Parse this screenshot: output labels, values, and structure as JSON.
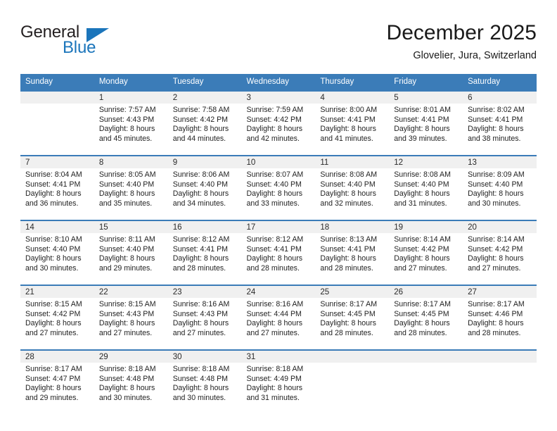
{
  "brand": {
    "line1": "General",
    "line2": "Blue",
    "triangle_icon": "triangle-icon",
    "color_dark": "#231f20",
    "color_blue": "#1b75bb"
  },
  "header": {
    "month_title": "December 2025",
    "location": "Glovelier, Jura, Switzerland"
  },
  "theme": {
    "header_blue": "#3b7cb8",
    "daynum_band": "#f0f0f0",
    "text": "#1a1a1a"
  },
  "calendar": {
    "weekdays": [
      "Sunday",
      "Monday",
      "Tuesday",
      "Wednesday",
      "Thursday",
      "Friday",
      "Saturday"
    ],
    "weeks": [
      [
        {
          "day": "",
          "empty": true,
          "sunrise": "",
          "sunset": "",
          "daylight1": "",
          "daylight2": ""
        },
        {
          "day": "1",
          "sunrise": "Sunrise: 7:57 AM",
          "sunset": "Sunset: 4:43 PM",
          "daylight1": "Daylight: 8 hours",
          "daylight2": "and 45 minutes."
        },
        {
          "day": "2",
          "sunrise": "Sunrise: 7:58 AM",
          "sunset": "Sunset: 4:42 PM",
          "daylight1": "Daylight: 8 hours",
          "daylight2": "and 44 minutes."
        },
        {
          "day": "3",
          "sunrise": "Sunrise: 7:59 AM",
          "sunset": "Sunset: 4:42 PM",
          "daylight1": "Daylight: 8 hours",
          "daylight2": "and 42 minutes."
        },
        {
          "day": "4",
          "sunrise": "Sunrise: 8:00 AM",
          "sunset": "Sunset: 4:41 PM",
          "daylight1": "Daylight: 8 hours",
          "daylight2": "and 41 minutes."
        },
        {
          "day": "5",
          "sunrise": "Sunrise: 8:01 AM",
          "sunset": "Sunset: 4:41 PM",
          "daylight1": "Daylight: 8 hours",
          "daylight2": "and 39 minutes."
        },
        {
          "day": "6",
          "sunrise": "Sunrise: 8:02 AM",
          "sunset": "Sunset: 4:41 PM",
          "daylight1": "Daylight: 8 hours",
          "daylight2": "and 38 minutes."
        }
      ],
      [
        {
          "day": "7",
          "sunrise": "Sunrise: 8:04 AM",
          "sunset": "Sunset: 4:41 PM",
          "daylight1": "Daylight: 8 hours",
          "daylight2": "and 36 minutes."
        },
        {
          "day": "8",
          "sunrise": "Sunrise: 8:05 AM",
          "sunset": "Sunset: 4:40 PM",
          "daylight1": "Daylight: 8 hours",
          "daylight2": "and 35 minutes."
        },
        {
          "day": "9",
          "sunrise": "Sunrise: 8:06 AM",
          "sunset": "Sunset: 4:40 PM",
          "daylight1": "Daylight: 8 hours",
          "daylight2": "and 34 minutes."
        },
        {
          "day": "10",
          "sunrise": "Sunrise: 8:07 AM",
          "sunset": "Sunset: 4:40 PM",
          "daylight1": "Daylight: 8 hours",
          "daylight2": "and 33 minutes."
        },
        {
          "day": "11",
          "sunrise": "Sunrise: 8:08 AM",
          "sunset": "Sunset: 4:40 PM",
          "daylight1": "Daylight: 8 hours",
          "daylight2": "and 32 minutes."
        },
        {
          "day": "12",
          "sunrise": "Sunrise: 8:08 AM",
          "sunset": "Sunset: 4:40 PM",
          "daylight1": "Daylight: 8 hours",
          "daylight2": "and 31 minutes."
        },
        {
          "day": "13",
          "sunrise": "Sunrise: 8:09 AM",
          "sunset": "Sunset: 4:40 PM",
          "daylight1": "Daylight: 8 hours",
          "daylight2": "and 30 minutes."
        }
      ],
      [
        {
          "day": "14",
          "sunrise": "Sunrise: 8:10 AM",
          "sunset": "Sunset: 4:40 PM",
          "daylight1": "Daylight: 8 hours",
          "daylight2": "and 30 minutes."
        },
        {
          "day": "15",
          "sunrise": "Sunrise: 8:11 AM",
          "sunset": "Sunset: 4:40 PM",
          "daylight1": "Daylight: 8 hours",
          "daylight2": "and 29 minutes."
        },
        {
          "day": "16",
          "sunrise": "Sunrise: 8:12 AM",
          "sunset": "Sunset: 4:41 PM",
          "daylight1": "Daylight: 8 hours",
          "daylight2": "and 28 minutes."
        },
        {
          "day": "17",
          "sunrise": "Sunrise: 8:12 AM",
          "sunset": "Sunset: 4:41 PM",
          "daylight1": "Daylight: 8 hours",
          "daylight2": "and 28 minutes."
        },
        {
          "day": "18",
          "sunrise": "Sunrise: 8:13 AM",
          "sunset": "Sunset: 4:41 PM",
          "daylight1": "Daylight: 8 hours",
          "daylight2": "and 28 minutes."
        },
        {
          "day": "19",
          "sunrise": "Sunrise: 8:14 AM",
          "sunset": "Sunset: 4:42 PM",
          "daylight1": "Daylight: 8 hours",
          "daylight2": "and 27 minutes."
        },
        {
          "day": "20",
          "sunrise": "Sunrise: 8:14 AM",
          "sunset": "Sunset: 4:42 PM",
          "daylight1": "Daylight: 8 hours",
          "daylight2": "and 27 minutes."
        }
      ],
      [
        {
          "day": "21",
          "sunrise": "Sunrise: 8:15 AM",
          "sunset": "Sunset: 4:42 PM",
          "daylight1": "Daylight: 8 hours",
          "daylight2": "and 27 minutes."
        },
        {
          "day": "22",
          "sunrise": "Sunrise: 8:15 AM",
          "sunset": "Sunset: 4:43 PM",
          "daylight1": "Daylight: 8 hours",
          "daylight2": "and 27 minutes."
        },
        {
          "day": "23",
          "sunrise": "Sunrise: 8:16 AM",
          "sunset": "Sunset: 4:43 PM",
          "daylight1": "Daylight: 8 hours",
          "daylight2": "and 27 minutes."
        },
        {
          "day": "24",
          "sunrise": "Sunrise: 8:16 AM",
          "sunset": "Sunset: 4:44 PM",
          "daylight1": "Daylight: 8 hours",
          "daylight2": "and 27 minutes."
        },
        {
          "day": "25",
          "sunrise": "Sunrise: 8:17 AM",
          "sunset": "Sunset: 4:45 PM",
          "daylight1": "Daylight: 8 hours",
          "daylight2": "and 28 minutes."
        },
        {
          "day": "26",
          "sunrise": "Sunrise: 8:17 AM",
          "sunset": "Sunset: 4:45 PM",
          "daylight1": "Daylight: 8 hours",
          "daylight2": "and 28 minutes."
        },
        {
          "day": "27",
          "sunrise": "Sunrise: 8:17 AM",
          "sunset": "Sunset: 4:46 PM",
          "daylight1": "Daylight: 8 hours",
          "daylight2": "and 28 minutes."
        }
      ],
      [
        {
          "day": "28",
          "sunrise": "Sunrise: 8:17 AM",
          "sunset": "Sunset: 4:47 PM",
          "daylight1": "Daylight: 8 hours",
          "daylight2": "and 29 minutes."
        },
        {
          "day": "29",
          "sunrise": "Sunrise: 8:18 AM",
          "sunset": "Sunset: 4:48 PM",
          "daylight1": "Daylight: 8 hours",
          "daylight2": "and 30 minutes."
        },
        {
          "day": "30",
          "sunrise": "Sunrise: 8:18 AM",
          "sunset": "Sunset: 4:48 PM",
          "daylight1": "Daylight: 8 hours",
          "daylight2": "and 30 minutes."
        },
        {
          "day": "31",
          "sunrise": "Sunrise: 8:18 AM",
          "sunset": "Sunset: 4:49 PM",
          "daylight1": "Daylight: 8 hours",
          "daylight2": "and 31 minutes."
        },
        {
          "day": "",
          "empty": true,
          "sunrise": "",
          "sunset": "",
          "daylight1": "",
          "daylight2": ""
        },
        {
          "day": "",
          "empty": true,
          "sunrise": "",
          "sunset": "",
          "daylight1": "",
          "daylight2": ""
        },
        {
          "day": "",
          "empty": true,
          "sunrise": "",
          "sunset": "",
          "daylight1": "",
          "daylight2": ""
        }
      ]
    ]
  }
}
